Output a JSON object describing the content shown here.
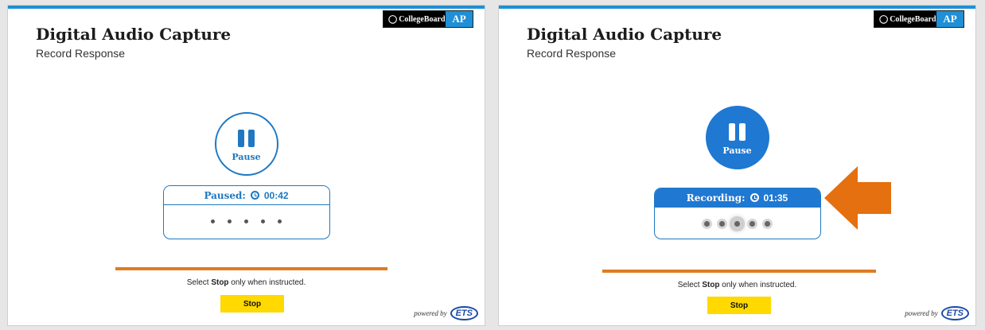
{
  "left": {
    "logo_cb": "CollegeBoard",
    "logo_ap": "AP",
    "title": "Digital Audio Capture",
    "subtitle": "Record Response",
    "pause_label": "Pause",
    "status_label": "Paused:",
    "timer": "00:42",
    "instruction_pre": "Select ",
    "instruction_bold": "Stop",
    "instruction_post": " only when instructed.",
    "stop_label": "Stop",
    "powered_by": "powered by",
    "ets": "ETS"
  },
  "right": {
    "logo_cb": "CollegeBoard",
    "logo_ap": "AP",
    "title": "Digital Audio Capture",
    "subtitle": "Record Response",
    "pause_label": "Pause",
    "status_label": "Recording:",
    "timer": "01:35",
    "instruction_pre": "Select ",
    "instruction_bold": "Stop",
    "instruction_post": " only when instructed.",
    "stop_label": "Stop",
    "powered_by": "powered by",
    "ets": "ETS"
  },
  "colors": {
    "accent_blue": "#1f78c1",
    "top_bar": "#1f8fd6",
    "orange": "#e07b22",
    "stop_yellow": "#ffd900",
    "arrow": "#e5700f"
  },
  "icons": [
    "pause-icon",
    "clock-icon",
    "collegeboard-shield-icon",
    "arrow-left-icon"
  ]
}
